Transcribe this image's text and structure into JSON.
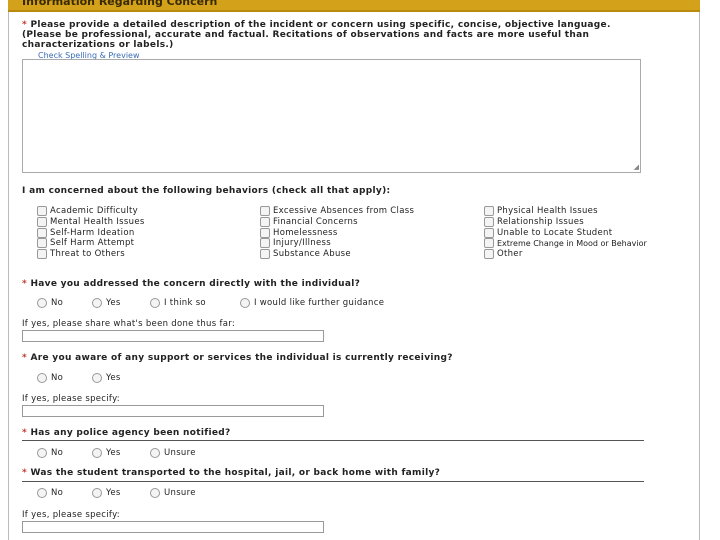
{
  "section_title": "Information Regarding Concern",
  "required_mark": "*",
  "description": {
    "prompt": "Please provide a detailed description of the incident or concern using specific, concise, objective language. (Please be professional, accurate and factual. Recitations of observations and facts are more useful than characterizations or labels.)",
    "spell_link": "Check Spelling & Preview",
    "value": ""
  },
  "behaviors": {
    "label": "I am concerned about the following behaviors (check all that apply):",
    "col1": [
      "Academic Difficulty",
      "Mental Health Issues",
      "Self-Harm Ideation",
      "Self Harm Attempt",
      "Threat to Others"
    ],
    "col2": [
      "Excessive Absences from Class",
      "Financial Concerns",
      "Homelessness",
      "Injury/Illness",
      "Substance Abuse"
    ],
    "col3": [
      "Physical Health Issues",
      "Relationship Issues",
      "Unable to Locate Student",
      "Extreme Change in Mood or Behavior",
      "Other"
    ]
  },
  "q_addressed": {
    "label": "Have you addressed the concern directly with the individual?",
    "options": [
      "No",
      "Yes",
      "I think so",
      "I would like further guidance"
    ],
    "followup": "If yes, please share what's been done thus far:"
  },
  "q_support": {
    "label": "Are you aware of any support or services the individual is currently receiving?",
    "options": [
      "No",
      "Yes"
    ],
    "followup": "If yes, please specify:"
  },
  "q_police": {
    "label": "Has any police agency been notified?",
    "options": [
      "No",
      "Yes",
      "Unsure"
    ]
  },
  "q_transport": {
    "label": "Was the student transported to the hospital, jail, or back home with family?",
    "options": [
      "No",
      "Yes",
      "Unsure"
    ],
    "followup": "If yes, please specify:"
  }
}
